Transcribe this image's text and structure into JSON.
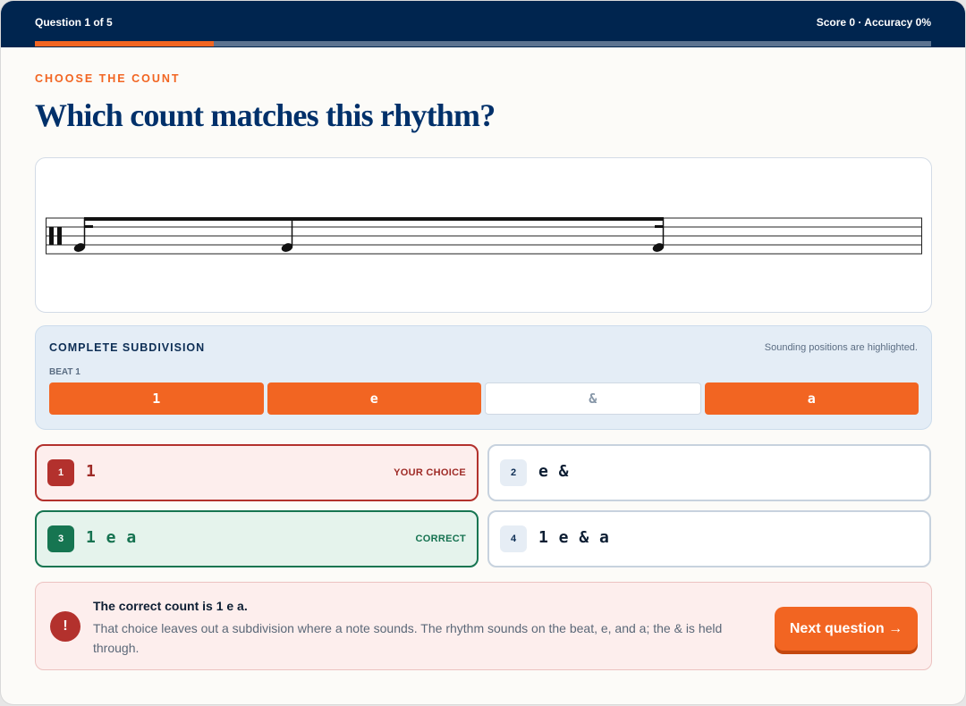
{
  "header": {
    "question_counter": "Question 1 of 5",
    "score": "Score 0 · Accuracy 0%",
    "progress_fraction": 0.2
  },
  "eyebrow": "CHOOSE THE COUNT",
  "title": "Which count matches this rhythm?",
  "subdivision": {
    "heading": "COMPLETE SUBDIVISION",
    "note": "Sounding positions are highlighted.",
    "beat_label": "BEAT 1",
    "cells": [
      {
        "label": "1",
        "sounding": true
      },
      {
        "label": "e",
        "sounding": true
      },
      {
        "label": "&",
        "sounding": false
      },
      {
        "label": "a",
        "sounding": true
      }
    ]
  },
  "options": [
    {
      "number": "1",
      "value": "1",
      "tag": "YOUR CHOICE",
      "state": "chosen"
    },
    {
      "number": "2",
      "value": "e &",
      "tag": "",
      "state": "neutral"
    },
    {
      "number": "3",
      "value": "1 e a",
      "tag": "CORRECT",
      "state": "correct"
    },
    {
      "number": "4",
      "value": "1 e & a",
      "tag": "",
      "state": "neutral"
    }
  ],
  "feedback": {
    "icon": "!",
    "title": "The correct count is 1 e a.",
    "body": "That choice leaves out a subdivision where a note sounds. The rhythm sounds on the beat, e, and a; the & is held through.",
    "next_label": "Next question →"
  },
  "colors": {
    "navy": "#00254f",
    "accent": "#f26522",
    "error": "#b3312d",
    "success": "#167551"
  }
}
